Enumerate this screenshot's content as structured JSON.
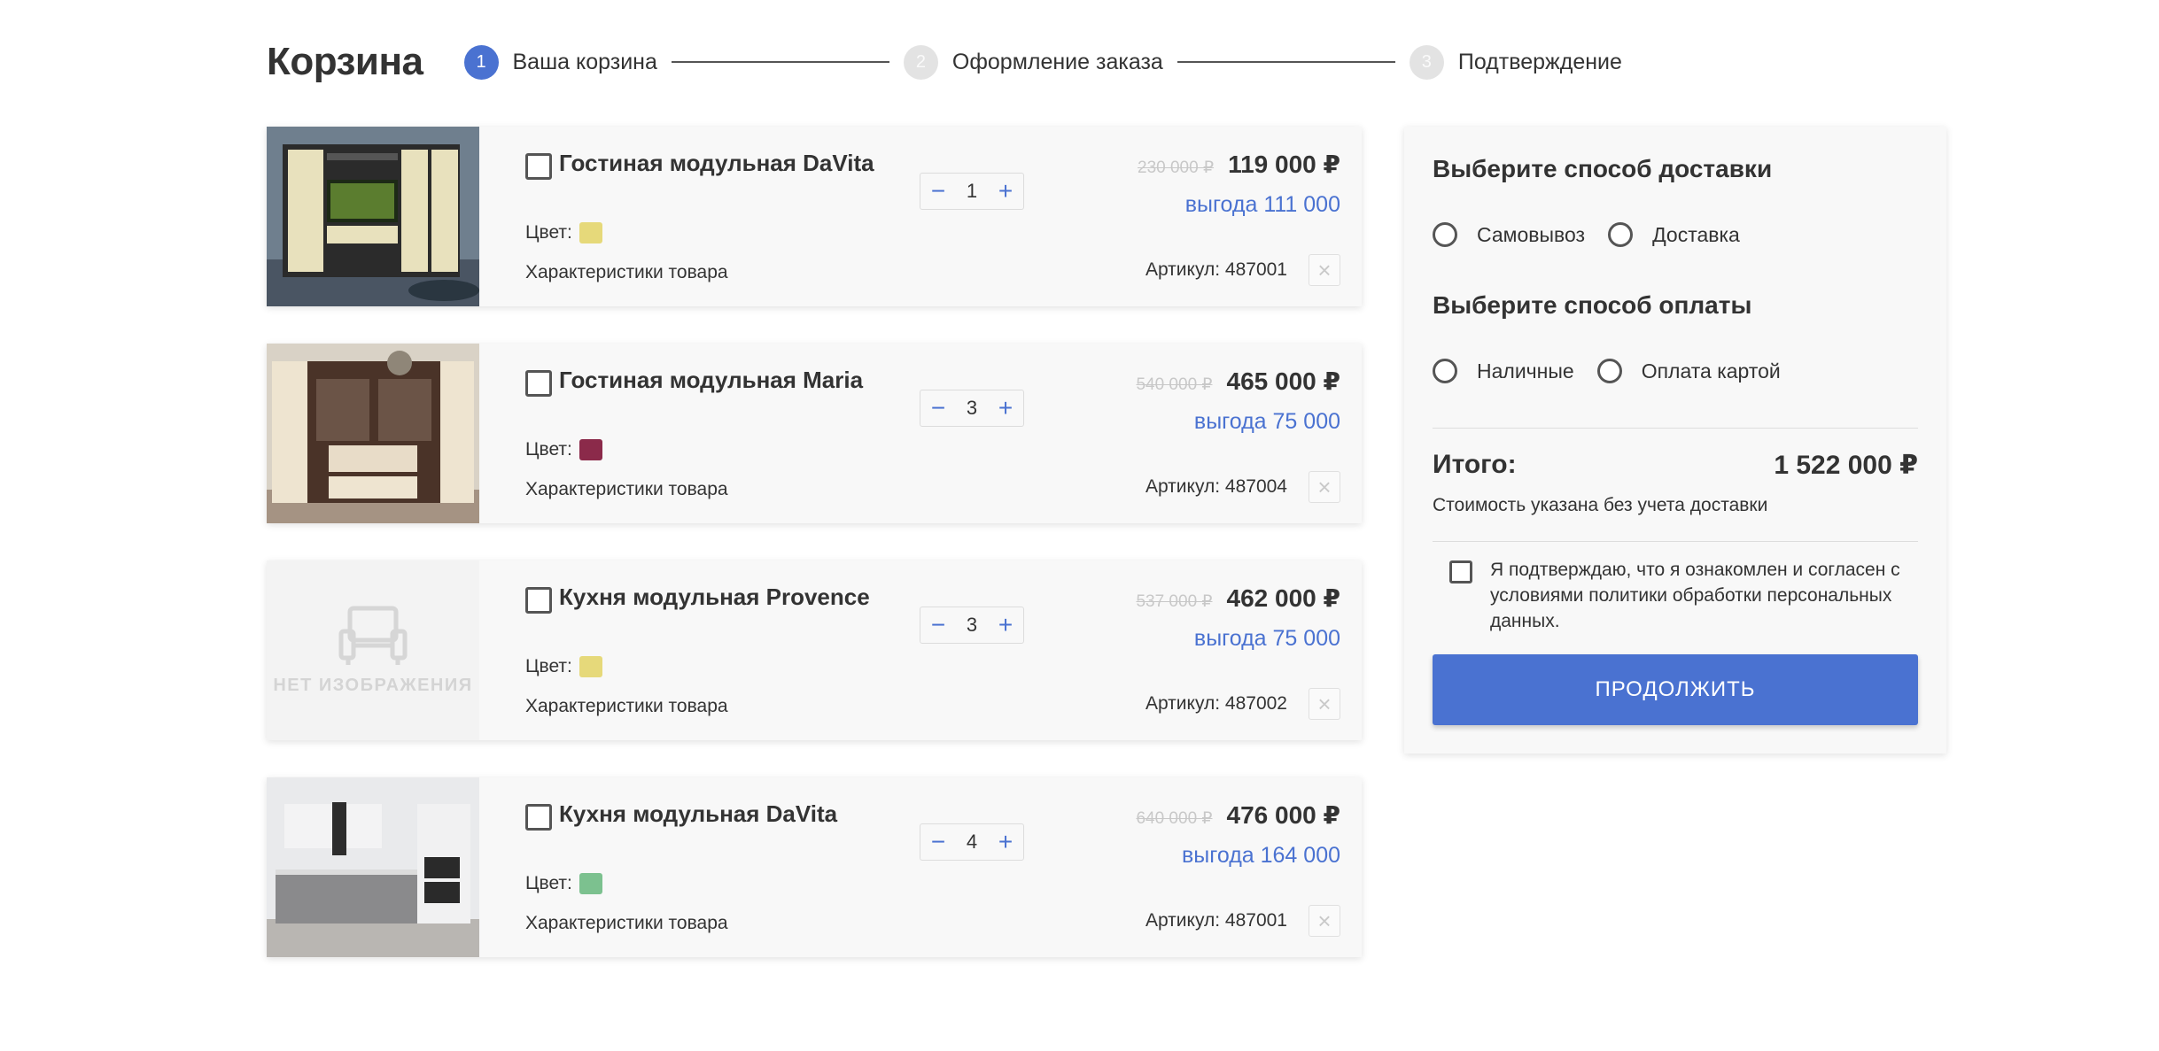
{
  "header": {
    "title": "Корзина",
    "steps": [
      {
        "num": "1",
        "label": "Ваша корзина"
      },
      {
        "num": "2",
        "label": "Оформление заказа"
      },
      {
        "num": "3",
        "label": "Подтверждение"
      }
    ]
  },
  "items": [
    {
      "name": "Гостиная модульная DaVita",
      "color_label": "Цвет:",
      "color": "#e6d97a",
      "specs": "Характеристики товара",
      "qty": "1",
      "old_price": "230 000 ₽",
      "price": "119 000 ₽",
      "saving": "выгода 111 000",
      "article": "Артикул: 487001",
      "image": "living-room-photo"
    },
    {
      "name": "Гостиная модульная Maria",
      "color_label": "Цвет:",
      "color": "#8b2a4a",
      "specs": "Характеристики товара",
      "qty": "3",
      "old_price": "540 000 ₽",
      "price": "465 000 ₽",
      "saving": "выгода 75 000",
      "article": "Артикул: 487004",
      "image": "living-room-photo"
    },
    {
      "name": "Кухня модульная Provence",
      "color_label": "Цвет:",
      "color": "#e6d97a",
      "specs": "Характеристики товара",
      "qty": "3",
      "old_price": "537 000 ₽",
      "price": "462 000 ₽",
      "saving": "выгода 75 000",
      "article": "Артикул: 487002",
      "image": "no-image",
      "no_image_text": "НЕТ ИЗОБРАЖЕНИЯ"
    },
    {
      "name": "Кухня модульная DaVita",
      "color_label": "Цвет:",
      "color": "#7cc18f",
      "specs": "Характеристики товара",
      "qty": "4",
      "old_price": "640 000 ₽",
      "price": "476 000 ₽",
      "saving": "выгода 164 000",
      "article": "Артикул: 487001",
      "image": "kitchen-photo"
    }
  ],
  "panel": {
    "delivery_title": "Выберите способ доставки",
    "delivery_options": [
      "Самовывоз",
      "Доставка"
    ],
    "payment_title": "Выберите способ оплаты",
    "payment_options": [
      "Наличные",
      "Оплата картой"
    ],
    "total_label": "Итого:",
    "total_value": "1 522 000 ₽",
    "total_note": "Стоимость указана без учета доставки",
    "consent": "Я подтверждаю, что я ознакомлен и согласен с условиями политики обработки персональных данных.",
    "continue_label": "ПРОДОЛЖИТЬ"
  },
  "colors": {
    "accent": "#4a72d1"
  },
  "icons": {
    "qty_minus": "−",
    "qty_plus": "+",
    "remove": "×"
  }
}
